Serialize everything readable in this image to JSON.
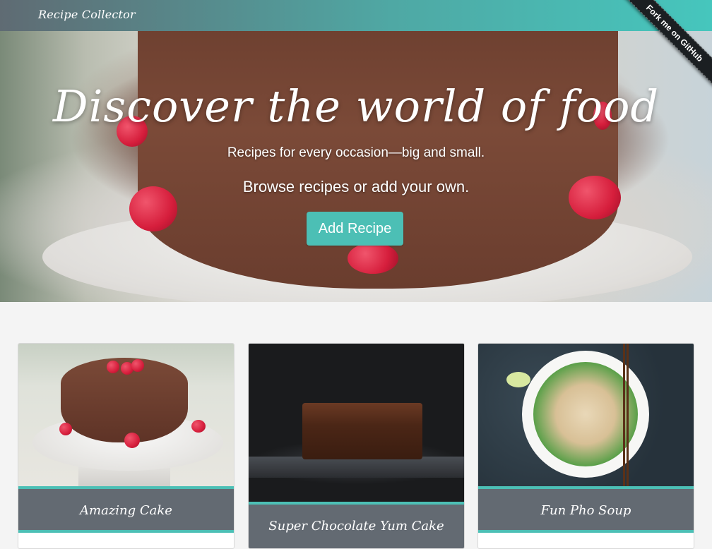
{
  "navbar": {
    "brand": "Recipe Collector"
  },
  "ribbon": {
    "label": "Fork me on GitHub"
  },
  "hero": {
    "title": "Discover the world of food",
    "subtitle": "Recipes for every occasion—big and small.",
    "tagline": "Browse recipes or add your own.",
    "add_button": "Add Recipe"
  },
  "cards": [
    {
      "title": "Amazing Cake"
    },
    {
      "title": "Super Chocolate Yum Cake"
    },
    {
      "title": "Fun Pho Soup"
    }
  ],
  "colors": {
    "accent": "#4cbfb5",
    "caption_bg": "#636a72",
    "page_bg": "#f4f4f4"
  }
}
